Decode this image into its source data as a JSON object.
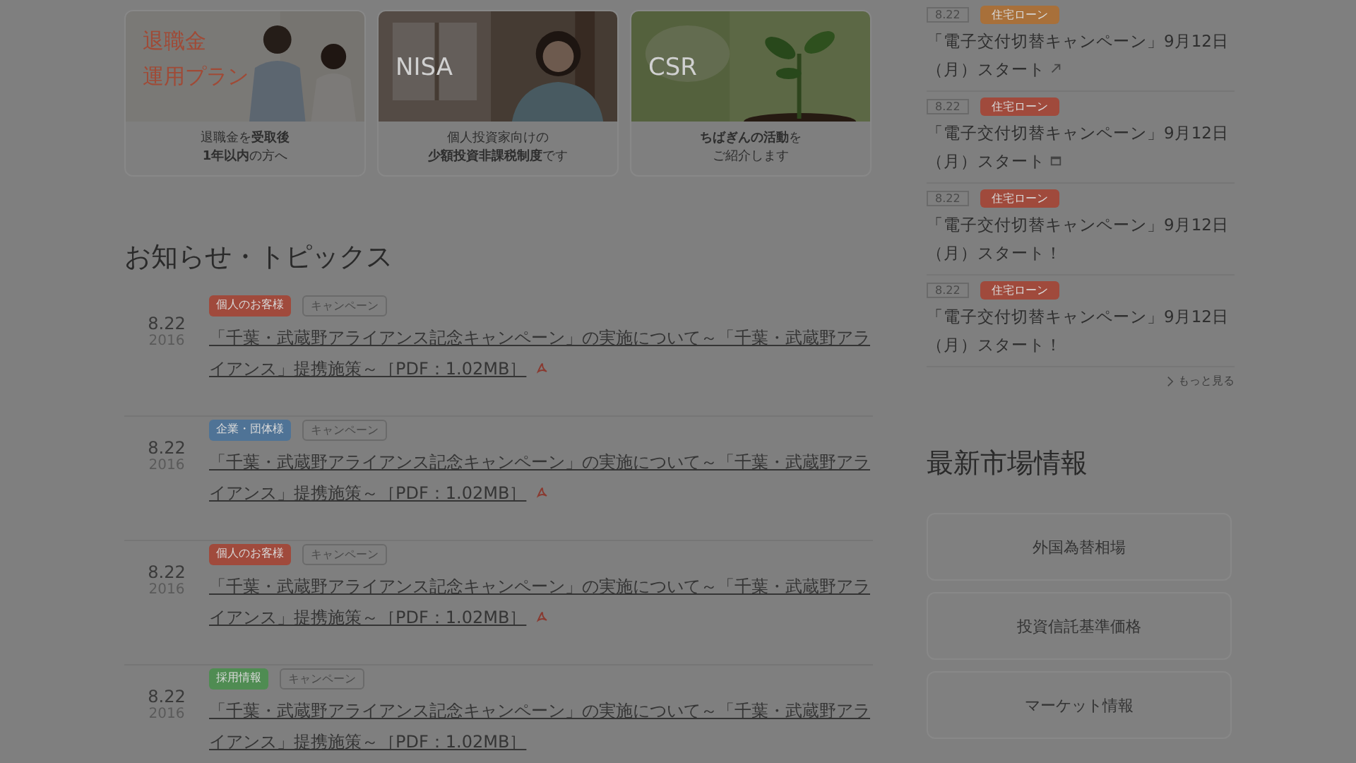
{
  "promo_cards": [
    {
      "title_lines": [
        "退職金",
        "運用プラン"
      ],
      "caption_lines": [
        "退職金を**受取後**",
        "**1年以内**の方へ"
      ]
    },
    {
      "title_lines": [
        "NISA"
      ],
      "caption_lines": [
        "個人投資家向けの",
        "**少額投資非課税制度**です"
      ]
    },
    {
      "title_lines": [
        "CSR"
      ],
      "caption_lines": [
        "**ちばぎんの活動**を",
        "ご紹介します"
      ]
    }
  ],
  "news_heading": "お知らせ・トピックス",
  "news": [
    {
      "date": "8.22",
      "year": "2016",
      "category": {
        "label": "個人のお客様",
        "color": "#a04a3c"
      },
      "type_tag": "キャンペーン",
      "title": "「千葉・武蔵野アライアンス記念キャンペーン」の実施について～「千葉・武蔵野アライアンス」提携施策～［PDF：1.02MB］",
      "pdf": true
    },
    {
      "date": "8.22",
      "year": "2016",
      "category": {
        "label": "企業・団体様",
        "color": "#4f7396"
      },
      "type_tag": "キャンペーン",
      "title": "「千葉・武蔵野アライアンス記念キャンペーン」の実施について～「千葉・武蔵野アライアンス」提携施策～［PDF：1.02MB］",
      "pdf": true
    },
    {
      "date": "8.22",
      "year": "2016",
      "category": {
        "label": "個人のお客様",
        "color": "#a04a3c"
      },
      "type_tag": "キャンペーン",
      "title": "「千葉・武蔵野アライアンス記念キャンペーン」の実施について～「千葉・武蔵野アライアンス」提携施策～［PDF：1.02MB］",
      "pdf": true
    },
    {
      "date": "8.22",
      "year": "2016",
      "category": {
        "label": "採用情報",
        "color": "#4f8c52"
      },
      "type_tag": "キャンペーン",
      "title": "「千葉・武蔵野アライアンス記念キャンペーン」の実施について～「千葉・武蔵野アライアンス」提携施策～［PDF：1.02MB］",
      "pdf": false
    }
  ],
  "side_news": [
    {
      "date": "8.22",
      "tag": {
        "label": "住宅ローン",
        "color": "#a8703a"
      },
      "text": "「電子交付切替キャンペーン」9月12日（月）スタート"
    },
    {
      "date": "8.22",
      "tag": {
        "label": "住宅ローン",
        "color": "#a04a3c"
      },
      "text": "「電子交付切替キャンペーン」9月12日（月）スタート"
    },
    {
      "date": "8.22",
      "tag": {
        "label": "住宅ローン",
        "color": "#a04a3c"
      },
      "text": "「電子交付切替キャンペーン」9月12日（月）スタート！"
    },
    {
      "date": "8.22",
      "tag": {
        "label": "住宅ローン",
        "color": "#a04a3c"
      },
      "text": "「電子交付切替キャンペーン」9月12日（月）スタート！"
    }
  ],
  "more_link": "もっと見る",
  "market_heading": "最新市場情報",
  "market_buttons": [
    "外国為替相場",
    "投資信託基準価格",
    "マーケット情報"
  ]
}
